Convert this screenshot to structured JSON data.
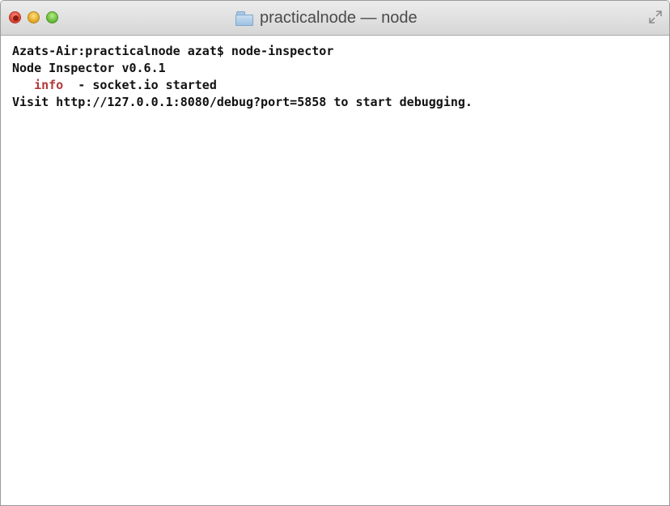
{
  "window": {
    "title": "practicalnode — node",
    "title_icon": "folder-icon",
    "controls": {
      "close": "close-button",
      "minimize": "minimize-button",
      "zoom": "zoom-button",
      "fullscreen": "fullscreen-icon"
    }
  },
  "terminal": {
    "lines": [
      "Azats-Air:practicalnode azat$ node-inspector",
      "Node Inspector v0.6.1"
    ],
    "info_line": {
      "indent": "   ",
      "tag": "info",
      "separator": "  - ",
      "message": "socket.io started"
    },
    "visit_line": "Visit http://127.0.0.1:8080/debug?port=5858 to start debugging.",
    "colors": {
      "text": "#111111",
      "info_tag": "#b23a3a",
      "background": "#ffffff"
    }
  }
}
